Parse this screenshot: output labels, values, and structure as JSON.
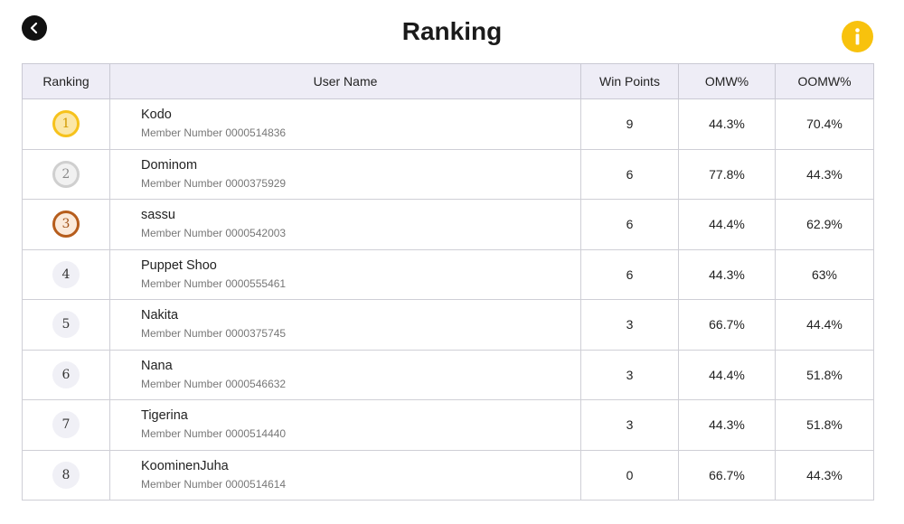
{
  "header": {
    "title": "Ranking"
  },
  "icons": {
    "back": "back-arrow-icon",
    "info": "info-icon"
  },
  "colors": {
    "info_button": "#f8c20d",
    "back_button": "#111111",
    "header_row": "#eeedf6",
    "gold": "#f6c21c",
    "silver": "#cfcfcf",
    "bronze": "#b65d1c"
  },
  "table": {
    "columns": [
      "Ranking",
      "User Name",
      "Win Points",
      "OMW%",
      "OOMW%"
    ],
    "rows": [
      {
        "rank": "1",
        "name": "Kodo",
        "member": "Member Number 0000514836",
        "win_points": "9",
        "omw": "44.3%",
        "oomw": "70.4%"
      },
      {
        "rank": "2",
        "name": "Dominom",
        "member": "Member Number 0000375929",
        "win_points": "6",
        "omw": "77.8%",
        "oomw": "44.3%"
      },
      {
        "rank": "3",
        "name": "sassu",
        "member": "Member Number 0000542003",
        "win_points": "6",
        "omw": "44.4%",
        "oomw": "62.9%"
      },
      {
        "rank": "4",
        "name": "Puppet Shoo",
        "member": "Member Number 0000555461",
        "win_points": "6",
        "omw": "44.3%",
        "oomw": "63%"
      },
      {
        "rank": "5",
        "name": "Nakita",
        "member": "Member Number 0000375745",
        "win_points": "3",
        "omw": "66.7%",
        "oomw": "44.4%"
      },
      {
        "rank": "6",
        "name": "Nana",
        "member": "Member Number 0000546632",
        "win_points": "3",
        "omw": "44.4%",
        "oomw": "51.8%"
      },
      {
        "rank": "7",
        "name": "Tigerina",
        "member": "Member Number 0000514440",
        "win_points": "3",
        "omw": "44.3%",
        "oomw": "51.8%"
      },
      {
        "rank": "8",
        "name": "KoominenJuha",
        "member": "Member Number 0000514614",
        "win_points": "0",
        "omw": "66.7%",
        "oomw": "44.3%"
      }
    ]
  }
}
